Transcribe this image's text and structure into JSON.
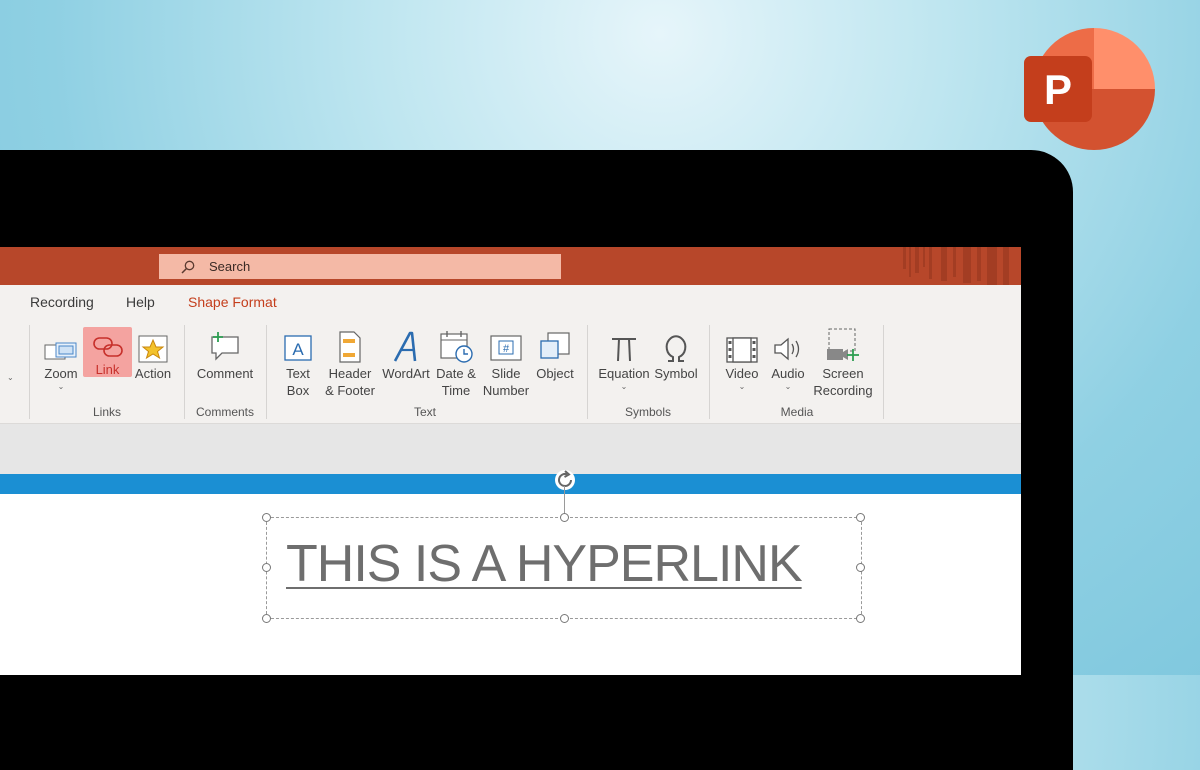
{
  "search": {
    "placeholder": "Search"
  },
  "tabs": [
    {
      "label": "Recording"
    },
    {
      "label": "Help"
    },
    {
      "label": "Shape Format"
    }
  ],
  "ribbon": {
    "links": {
      "zoom": "Zoom",
      "link": "Link",
      "action": "Action",
      "group": "Links"
    },
    "comments": {
      "comment": "Comment",
      "group": "Comments"
    },
    "text": {
      "text_box_1": "Text",
      "text_box_2": "Box",
      "header_1": "Header",
      "header_2": "& Footer",
      "wordart": "WordArt",
      "date_1": "Date &",
      "date_2": "Time",
      "slide_1": "Slide",
      "slide_2": "Number",
      "object": "Object",
      "group": "Text"
    },
    "symbols": {
      "equation": "Equation",
      "symbol": "Symbol",
      "group": "Symbols"
    },
    "media": {
      "video": "Video",
      "audio": "Audio",
      "screen_1": "Screen",
      "screen_2": "Recording",
      "group": "Media"
    }
  },
  "slide": {
    "hyperlink_text": "THIS IS A HYPERLINK"
  },
  "colors": {
    "accent": "#b7472a",
    "active_tab": "#c43e1c",
    "link_highlight": "#f4a3a0",
    "selection_bar": "#1b8fd3"
  },
  "logo": {
    "letter": "P"
  }
}
